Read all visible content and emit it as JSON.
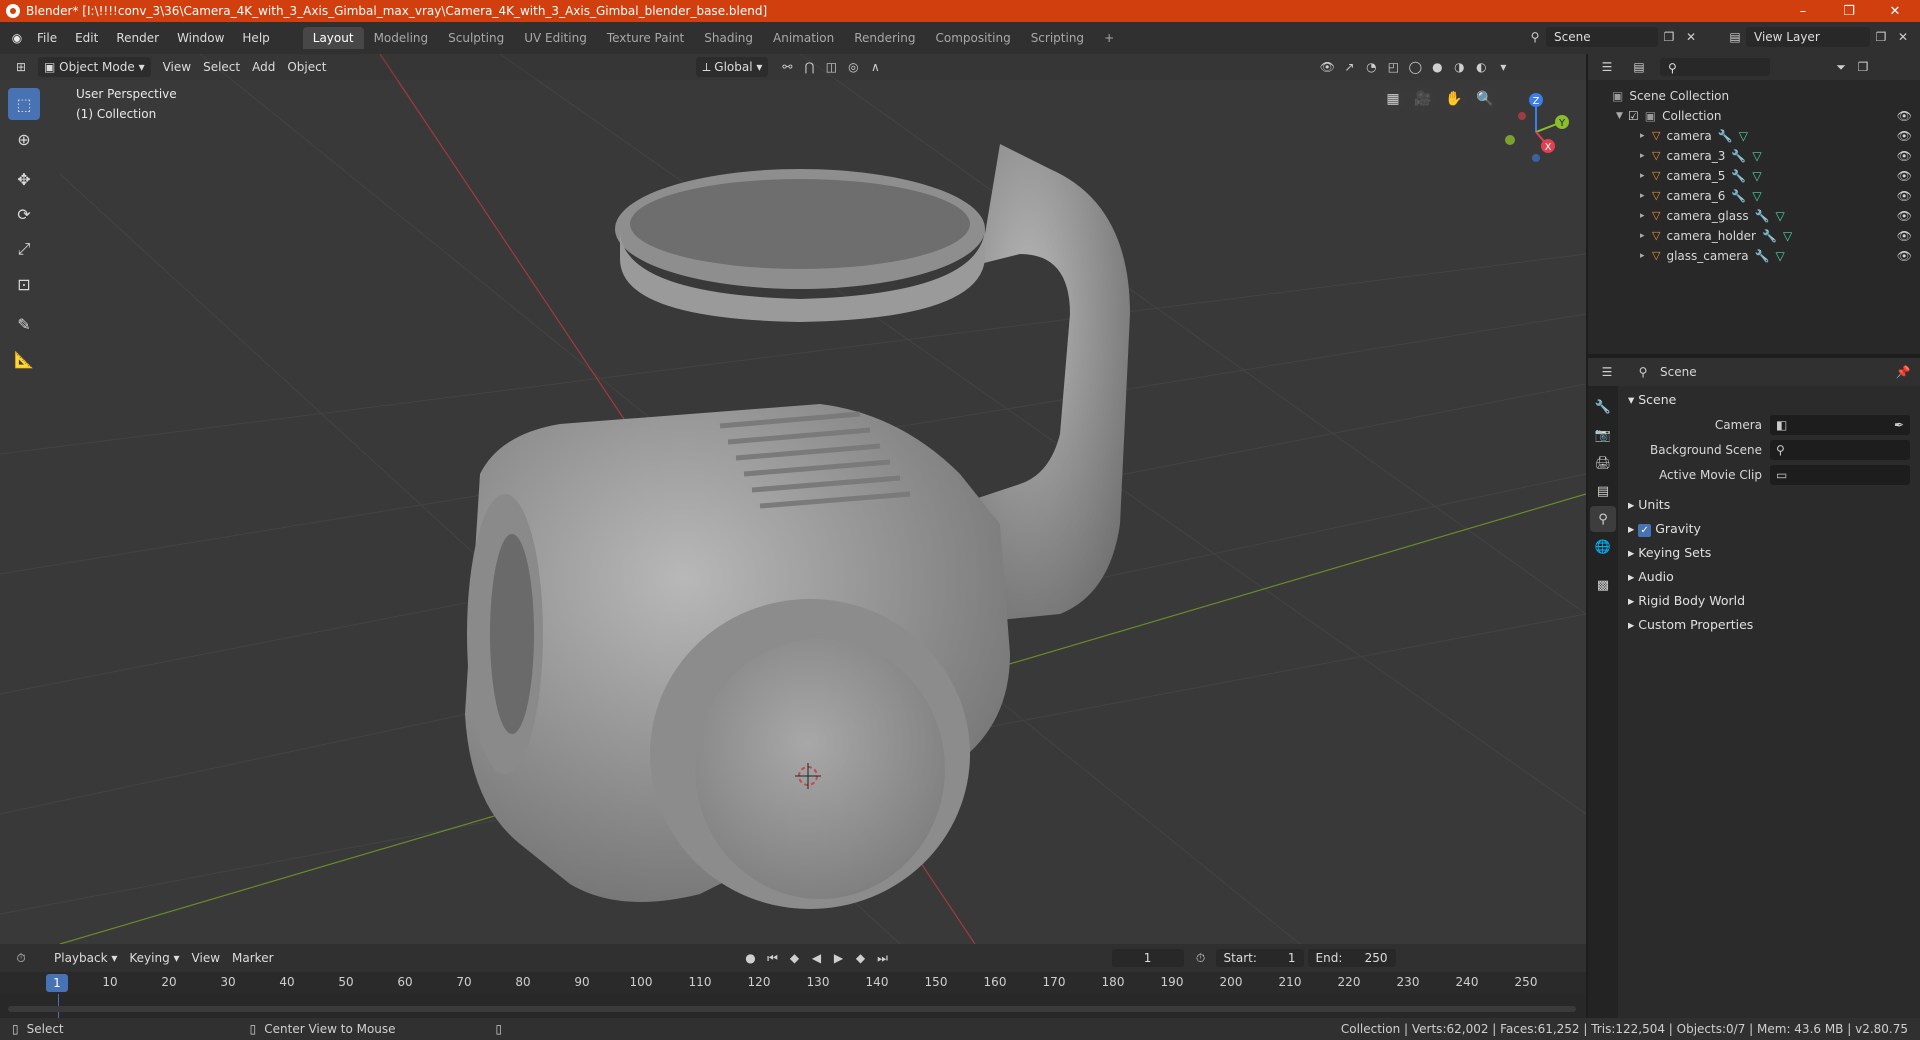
{
  "window": {
    "title": "Blender* [I:\\!!!!conv_3\\36\\Camera_4K_with_3_Axis_Gimbal_max_vray\\Camera_4K_with_3_Axis_Gimbal_blender_base.blend]",
    "minimize": "–",
    "maximize": "❐",
    "close": "✕"
  },
  "menu": [
    "File",
    "Edit",
    "Render",
    "Window",
    "Help"
  ],
  "workspaces": [
    "Layout",
    "Modeling",
    "Sculpting",
    "UV Editing",
    "Texture Paint",
    "Shading",
    "Animation",
    "Rendering",
    "Compositing",
    "Scripting"
  ],
  "add_workspace": "+",
  "scene_field": "Scene",
  "view_layer_field": "View Layer",
  "viewport": {
    "mode": "Object Mode",
    "menus": [
      "View",
      "Select",
      "Add",
      "Object"
    ],
    "orientation": "Global",
    "info_line1": "User Perspective",
    "info_line2": "(1) Collection"
  },
  "gizmo": {
    "z": "Z",
    "y": "Y",
    "x": "X"
  },
  "outliner": {
    "search_placeholder": "",
    "scene_collection": "Scene Collection",
    "collection": "Collection",
    "objects": [
      "camera",
      "camera_3",
      "camera_5",
      "camera_6",
      "camera_glass",
      "camera_holder",
      "glass_camera"
    ]
  },
  "properties": {
    "header": "Scene",
    "panel_title": "Scene",
    "rows": [
      {
        "label": "Camera",
        "value": ""
      },
      {
        "label": "Background Scene",
        "value": ""
      },
      {
        "label": "Active Movie Clip",
        "value": ""
      }
    ],
    "collapsed_panels": [
      "Units",
      "Gravity",
      "Keying Sets",
      "Audio",
      "Rigid Body World",
      "Custom Properties"
    ],
    "gravity_checked": true
  },
  "timeline": {
    "menus": [
      "Playback",
      "Keying",
      "View",
      "Marker"
    ],
    "current_frame": "1",
    "start_label": "Start:",
    "start": "1",
    "end_label": "End:",
    "end": "250",
    "ticks": [
      "10",
      "20",
      "30",
      "40",
      "50",
      "60",
      "70",
      "80",
      "90",
      "100",
      "110",
      "120",
      "130",
      "140",
      "150",
      "160",
      "170",
      "180",
      "190",
      "200",
      "210",
      "220",
      "230",
      "240",
      "250"
    ],
    "ruler_frame": "1"
  },
  "status": {
    "left": "Select",
    "middle": "Center View to Mouse",
    "right": "Collection | Verts:62,002 | Faces:61,252 | Tris:122,504 | Objects:0/7 | Mem: 43.6 MB | v2.80.75"
  }
}
